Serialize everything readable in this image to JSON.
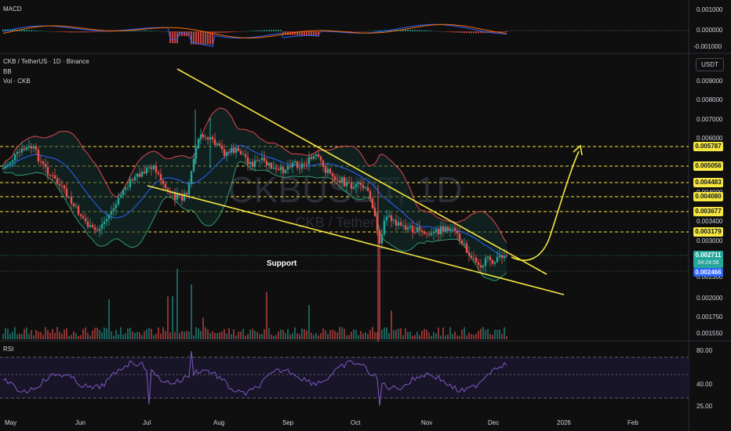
{
  "chart_data": {
    "type": "candlestick",
    "symbol": "CKB / TetherUS · 1D · Binance",
    "overlay_labels": [
      "BB",
      "Vol · CKB"
    ],
    "watermark": "CKBUSDT, 1D",
    "watermark_sub": "CKB / TetherUS",
    "currency": "USDT",
    "x_ticks": [
      "May",
      "Jun",
      "Jul",
      "Aug",
      "Sep",
      "Oct",
      "Nov",
      "Dec",
      "2026",
      "Feb"
    ],
    "price_ticks": [
      "0.009000",
      "0.008000",
      "0.007000",
      "0.006000",
      "0.005000",
      "0.004000",
      "0.003400",
      "0.003000",
      "0.002300",
      "0.002000",
      "0.001750",
      "0.001550"
    ],
    "key_levels": [
      {
        "label": "0.005787",
        "style": "yellow"
      },
      {
        "label": "0.005056",
        "style": "yellow"
      },
      {
        "label": "0.004483",
        "style": "yellow"
      },
      {
        "label": "0.004080",
        "style": "yellow"
      },
      {
        "label": "0.003677",
        "style": "yellow"
      },
      {
        "label": "0.003179",
        "style": "yellow"
      }
    ],
    "current_price": "0.002711",
    "countdown": "04:24:56",
    "support_price": "0.002466",
    "annotation": "Support",
    "macd": {
      "title": "MACD",
      "ticks": [
        "0.001000",
        "0.000000",
        "-0.001000"
      ]
    },
    "rsi": {
      "title": "RSI",
      "ticks": [
        "80.00",
        "40.00",
        "25.00"
      ]
    }
  },
  "colors": {
    "up": "#26a69a",
    "down": "#ef5350",
    "bb_upper": "#e0484f",
    "bb_lower": "#2e9a6e",
    "bb_basis": "#2962ff",
    "yellow": "#f5e642",
    "rsi": "#7e57c2"
  }
}
